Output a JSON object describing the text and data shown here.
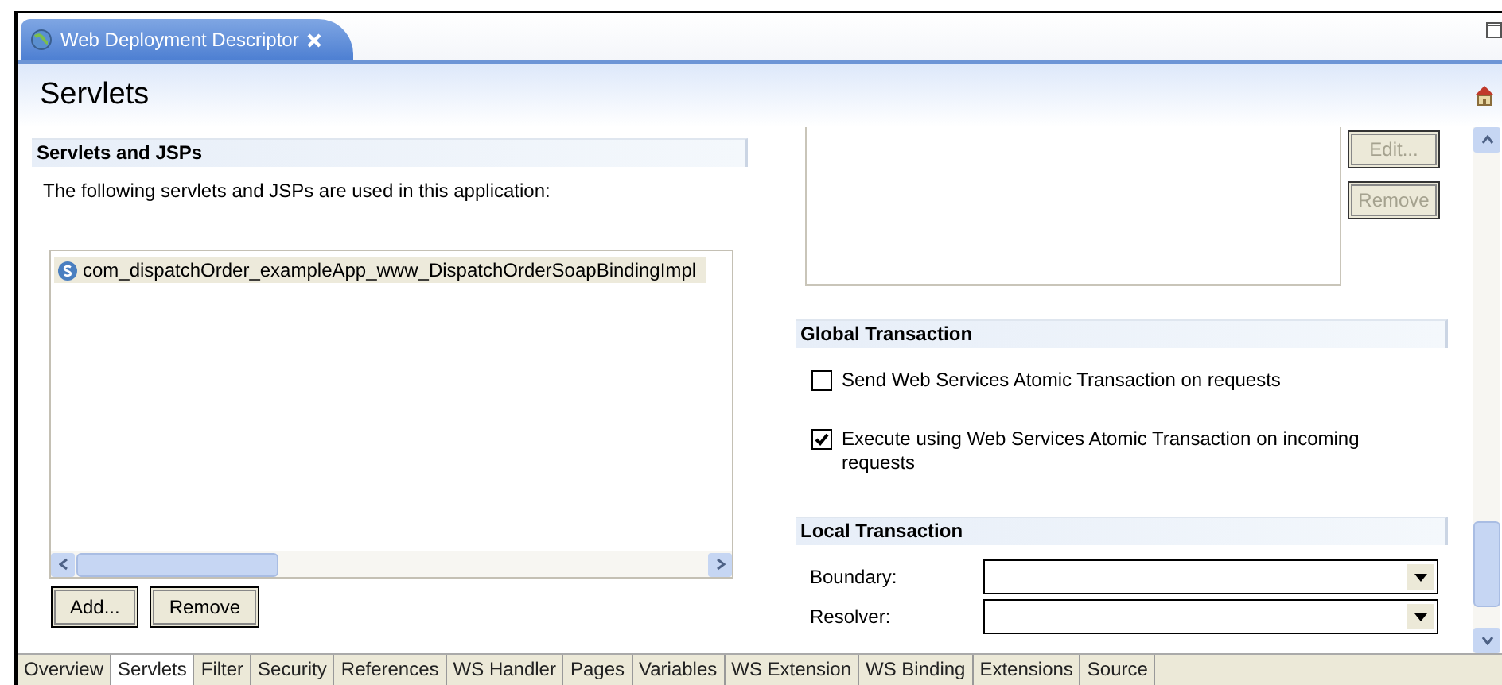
{
  "editor_tab": {
    "title": "Web Deployment Descriptor"
  },
  "page_title": "Servlets",
  "servlets_section": {
    "title": "Servlets and JSPs",
    "description": "The following servlets and JSPs are used in this application:",
    "items": [
      {
        "label": "com_dispatchOrder_exampleApp_www_DispatchOrderSoapBindingImpl",
        "selected": true
      }
    ],
    "buttons": [
      {
        "label": "Add...",
        "disabled": false
      },
      {
        "label": "Remove",
        "disabled": false
      }
    ]
  },
  "side_buttons": [
    {
      "label": "Edit...",
      "disabled": true
    },
    {
      "label": "Remove",
      "disabled": true
    }
  ],
  "global_transaction": {
    "title": "Global Transaction",
    "options": [
      {
        "label": "Send Web Services Atomic Transaction on requests",
        "checked": false
      },
      {
        "label": "Execute using Web Services Atomic Transaction on incoming requests",
        "checked": true
      }
    ]
  },
  "local_transaction": {
    "title": "Local Transaction",
    "fields": [
      {
        "label": "Boundary:"
      },
      {
        "label": "Resolver:"
      }
    ]
  },
  "page_tabs": [
    {
      "label": "Overview",
      "selected": false
    },
    {
      "label": "Servlets",
      "selected": true
    },
    {
      "label": "Filter",
      "selected": false
    },
    {
      "label": "Security",
      "selected": false
    },
    {
      "label": "References",
      "selected": false
    },
    {
      "label": "WS Handler",
      "selected": false
    },
    {
      "label": "Pages",
      "selected": false
    },
    {
      "label": "Variables",
      "selected": false
    },
    {
      "label": "WS Extension",
      "selected": false
    },
    {
      "label": "WS Binding",
      "selected": false
    },
    {
      "label": "Extensions",
      "selected": false
    },
    {
      "label": "Source",
      "selected": false
    }
  ]
}
